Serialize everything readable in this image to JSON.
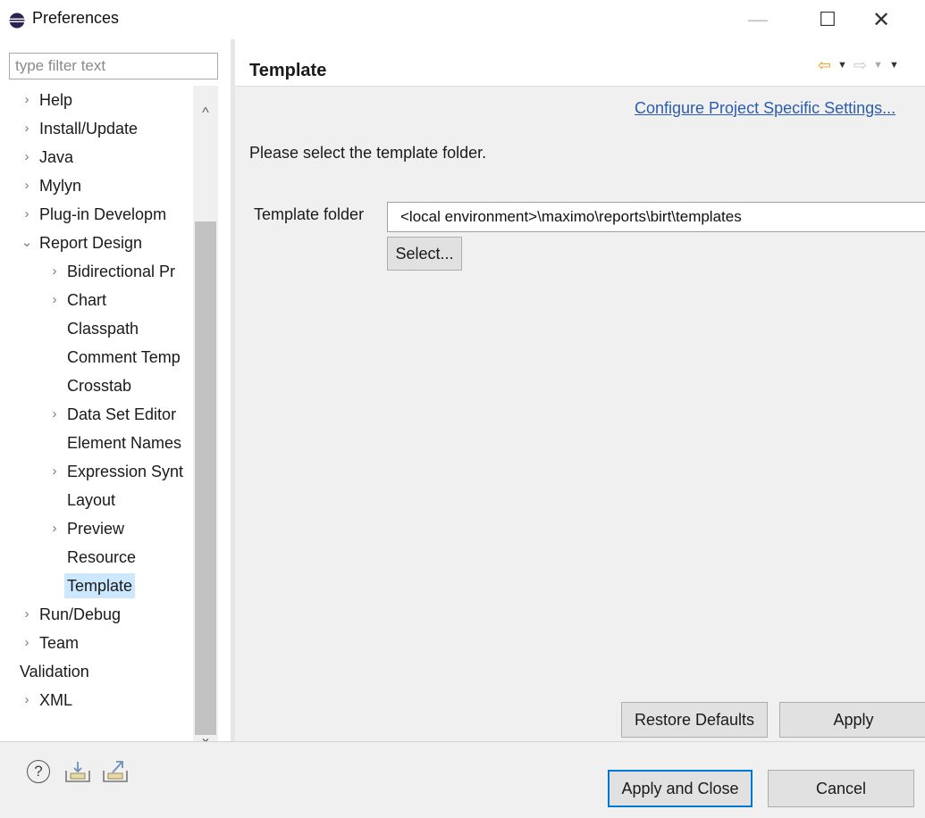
{
  "window": {
    "title": "Preferences",
    "minimize_glyph": "—",
    "maximize_glyph": "☐",
    "close_glyph": "✕"
  },
  "sidebar": {
    "filter_placeholder": "type filter text",
    "scroll_up_glyph": "^",
    "scroll_down_glyph": "⌄",
    "scroll_left_glyph": "<",
    "scroll_right_glyph": ">",
    "items": [
      {
        "label": "Help",
        "arrow": "›",
        "level": 0
      },
      {
        "label": "Install/Update",
        "arrow": "›",
        "level": 0
      },
      {
        "label": "Java",
        "arrow": "›",
        "level": 0
      },
      {
        "label": "Mylyn",
        "arrow": "›",
        "level": 0
      },
      {
        "label": "Plug-in Developm",
        "arrow": "›",
        "level": 0
      },
      {
        "label": "Report Design",
        "arrow": "⌄",
        "level": 0
      },
      {
        "label": "Bidirectional Pr",
        "arrow": "›",
        "level": 1
      },
      {
        "label": "Chart",
        "arrow": "›",
        "level": 1
      },
      {
        "label": "Classpath",
        "arrow": "",
        "level": 1
      },
      {
        "label": "Comment Temp",
        "arrow": "",
        "level": 1
      },
      {
        "label": "Crosstab",
        "arrow": "",
        "level": 1
      },
      {
        "label": "Data Set Editor",
        "arrow": "›",
        "level": 1
      },
      {
        "label": "Element Names",
        "arrow": "",
        "level": 1
      },
      {
        "label": "Expression Synt",
        "arrow": "›",
        "level": 1
      },
      {
        "label": "Layout",
        "arrow": "",
        "level": 1
      },
      {
        "label": "Preview",
        "arrow": "›",
        "level": 1
      },
      {
        "label": "Resource",
        "arrow": "",
        "level": 1
      },
      {
        "label": "Template",
        "arrow": "",
        "level": 1,
        "selected": true
      },
      {
        "label": "Run/Debug",
        "arrow": "›",
        "level": 0
      },
      {
        "label": "Team",
        "arrow": "›",
        "level": 0
      },
      {
        "label": "Validation",
        "arrow": "",
        "level": 0
      },
      {
        "label": "XML",
        "arrow": "›",
        "level": 0
      }
    ]
  },
  "page": {
    "title": "Template",
    "nav": {
      "back": "⇦",
      "back_menu": "▼",
      "forward": "⇨",
      "forward_menu": "▼",
      "view_menu": "▼"
    },
    "config_link": "Configure Project Specific Settings...",
    "description": "Please select the template folder.",
    "folder_label": "Template folder",
    "folder_value": "<local environment>\\maximo\\reports\\birt\\templates",
    "select_button": "Select...",
    "restore_defaults_button": "Restore Defaults",
    "apply_button": "Apply"
  },
  "footer": {
    "help_glyph": "?",
    "apply_close_button": "Apply and Close",
    "cancel_button": "Cancel"
  },
  "colors": {
    "accent": "#0078d7",
    "link": "#2a5db0",
    "selection": "#cce8ff",
    "nav_back": "#e0a020"
  }
}
